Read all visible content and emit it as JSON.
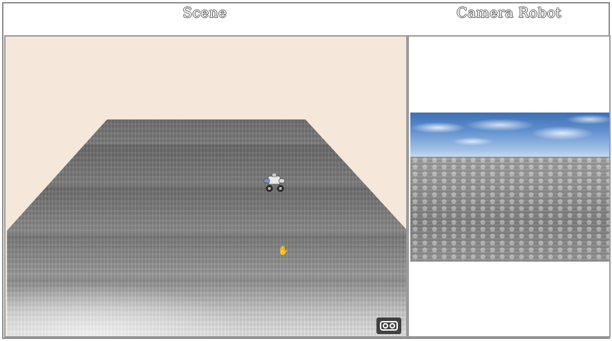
{
  "panels": {
    "scene_title": "Scene",
    "camera_title": "Camera Robot"
  },
  "icons": {
    "vr": "vr-headset-icon",
    "cursor": "hand-cursor-icon",
    "robot": "robot-model"
  },
  "colors": {
    "scene_background": "#f5e8db",
    "floor": "#7e7e7e",
    "sky": "#5f8fcf"
  }
}
